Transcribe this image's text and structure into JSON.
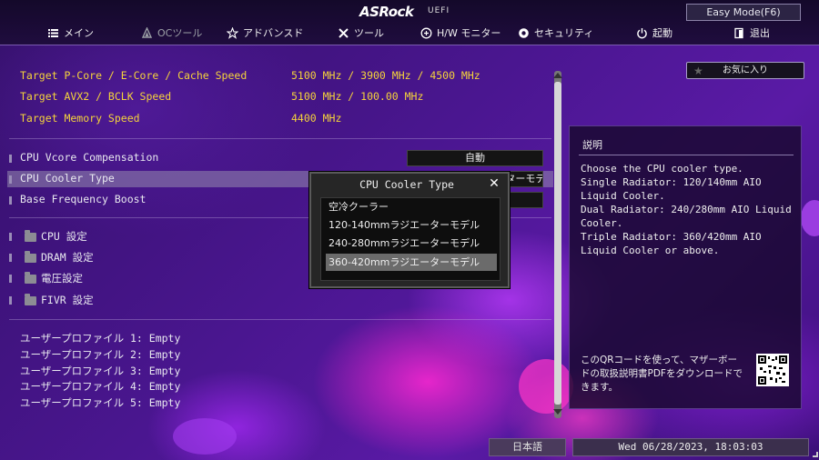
{
  "brand": {
    "name": "ASRock",
    "sub": "UEFI"
  },
  "easy_mode_label": "Easy Mode(F6)",
  "nav": [
    {
      "label": "メイン",
      "icon": "list-icon"
    },
    {
      "label": "OCツール",
      "icon": "flame-icon"
    },
    {
      "label": "アドバンスド",
      "icon": "star-icon"
    },
    {
      "label": "ツール",
      "icon": "tools-icon"
    },
    {
      "label": "H/W モニター",
      "icon": "monitor-icon"
    },
    {
      "label": "セキュリティ",
      "icon": "shield-icon"
    },
    {
      "label": "起動",
      "icon": "power-icon"
    },
    {
      "label": "退出",
      "icon": "exit-icon"
    }
  ],
  "targets": [
    {
      "label": "Target P-Core / E-Core / Cache Speed",
      "value": "5100 MHz / 3900 MHz / 4500 MHz"
    },
    {
      "label": "Target AVX2 / BCLK Speed",
      "value": "5100 MHz / 100.00 MHz"
    },
    {
      "label": "Target Memory Speed",
      "value": "4400 MHz"
    }
  ],
  "settings": [
    {
      "label": "CPU Vcore Compensation",
      "value": "自動"
    },
    {
      "label": "CPU Cooler Type",
      "value": "360-420mmラジエーターモデル"
    },
    {
      "label": "Base Frequency Boost",
      "value": ""
    }
  ],
  "folders": [
    {
      "label": "CPU 設定"
    },
    {
      "label": "DRAM 設定"
    },
    {
      "label": "電圧設定"
    },
    {
      "label": "FIVR 設定"
    }
  ],
  "profiles": [
    "ユーザープロファイル 1: Empty",
    "ユーザープロファイル 2: Empty",
    "ユーザープロファイル 3: Empty",
    "ユーザープロファイル 4: Empty",
    "ユーザープロファイル 5: Empty"
  ],
  "favorites_label": "お気に入り",
  "description": {
    "title": "説明",
    "body": "Choose the CPU cooler type.\nSingle Radiator: 120/140mm AIO\nLiquid Cooler.\nDual Radiator: 240/280mm AIO Liquid\nCooler.\nTriple Radiator: 360/420mm AIO\nLiquid Cooler or above.",
    "qr_text": "このQRコードを使って、マザーボードの取扱説明書PDFをダウンロードできます。"
  },
  "dialog": {
    "title": "CPU Cooler Type",
    "options": [
      "空冷クーラー",
      "120-140mmラジエーターモデル",
      "240-280mmラジエーターモデル",
      "360-420mmラジエーターモデル"
    ],
    "selected_index": 3
  },
  "language": "日本語",
  "datetime": "Wed 06/28/2023, 18:03:03",
  "colors": {
    "accent_yellow": "#f5d33b",
    "highlight": "#969baf"
  }
}
